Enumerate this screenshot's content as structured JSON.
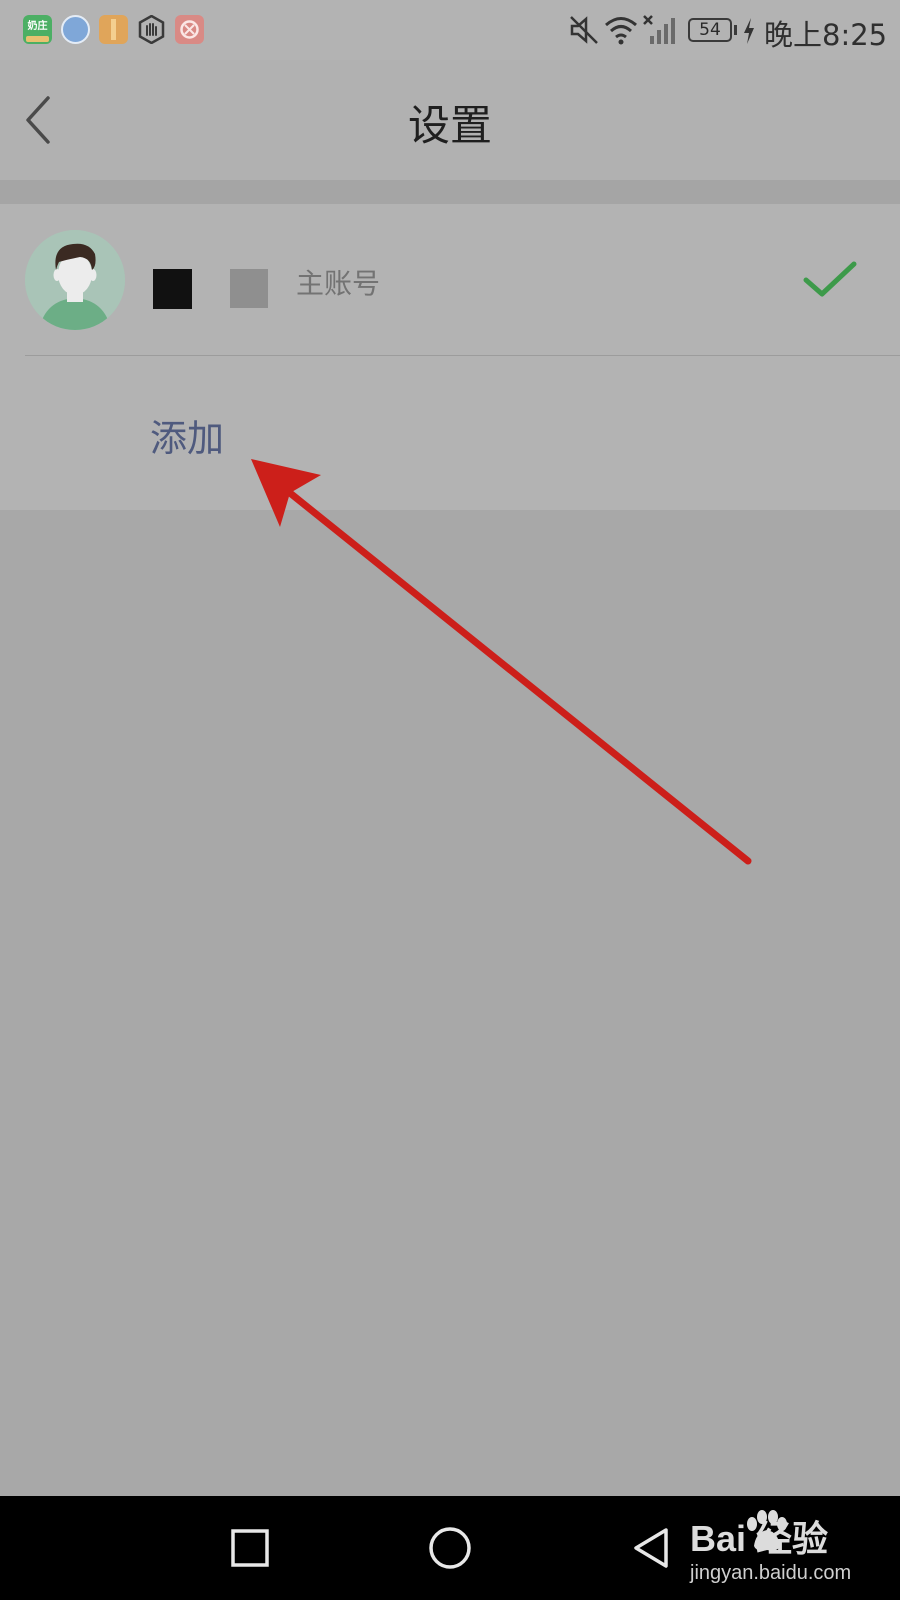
{
  "status_bar": {
    "notification_icons": [
      {
        "name": "app-icon-green-badge",
        "text": "奶庄"
      },
      {
        "name": "app-icon-blue-globe"
      },
      {
        "name": "app-icon-orange-package"
      },
      {
        "name": "hand-stop-icon"
      },
      {
        "name": "app-icon-red"
      }
    ],
    "battery_level": "54",
    "time": "晚上8:25"
  },
  "header": {
    "title": "设置"
  },
  "accounts": {
    "current_account": {
      "type_label": "主账号",
      "selected": true
    },
    "add_label": "添加"
  },
  "watermark": {
    "brand_text": "Bai  经验",
    "url_text": "jingyan.baidu.com"
  },
  "colors": {
    "check": "#3d9a4a",
    "add_text": "#4f5a7e",
    "arrow": "#cc1f1a"
  }
}
